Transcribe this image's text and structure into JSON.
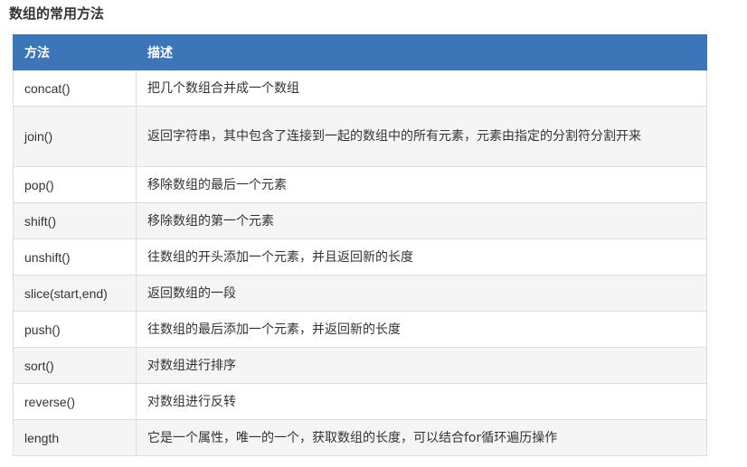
{
  "page_title": "数组的常用方法",
  "table": {
    "headers": {
      "method": "方法",
      "description": "描述"
    },
    "rows": [
      {
        "method": "concat()",
        "description": "把几个数组合并成一个数组"
      },
      {
        "method": "join()",
        "description": "返回字符串，其中包含了连接到一起的数组中的所有元素，元素由指定的分割符分割开来"
      },
      {
        "method": "pop()",
        "description": "移除数组的最后一个元素"
      },
      {
        "method": "shift()",
        "description": "移除数组的第一个元素"
      },
      {
        "method": "unshift()",
        "description": "往数组的开头添加一个元素，并且返回新的长度"
      },
      {
        "method": "slice(start,end)",
        "description": "返回数组的一段"
      },
      {
        "method": "push()",
        "description": "往数组的最后添加一个元素，并返回新的长度"
      },
      {
        "method": "sort()",
        "description": "对数组进行排序"
      },
      {
        "method": "reverse()",
        "description": "对数组进行反转"
      },
      {
        "method": "length",
        "description": "它是一个属性，唯一的一个，获取数组的长度，可以结合for循环遍历操作"
      }
    ]
  },
  "colors": {
    "header_bg": "#3d75b9",
    "header_text": "#ffffff",
    "row_alt_bg": "#f5f5f5",
    "border": "#dddddd"
  }
}
